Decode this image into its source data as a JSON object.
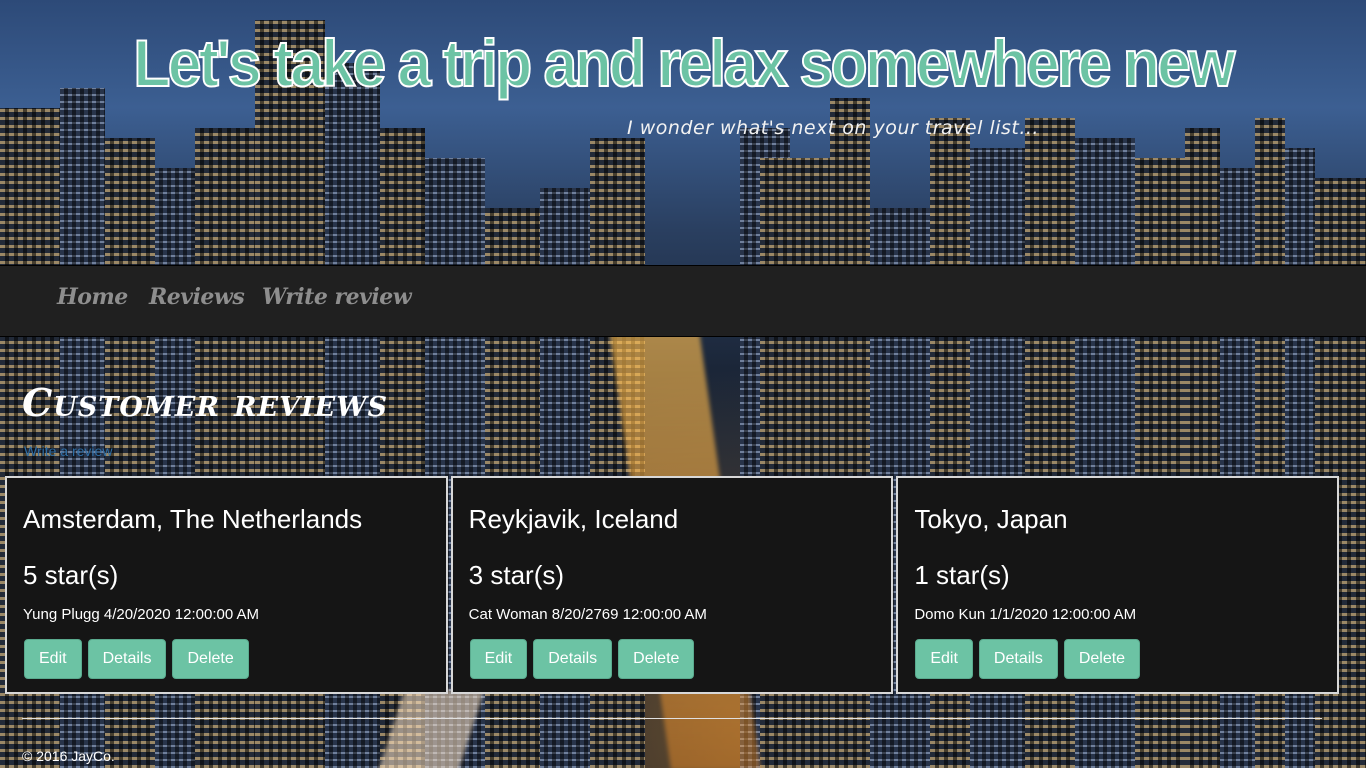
{
  "header": {
    "title": "Let's take a trip and relax somewhere new",
    "tagline": "I wonder what's next on your travel list..."
  },
  "nav": {
    "items": [
      {
        "label": "Home"
      },
      {
        "label": "Reviews"
      },
      {
        "label": "Write review"
      }
    ]
  },
  "main": {
    "heading": "Customer reviews",
    "write_link": "Write a review",
    "reviews": [
      {
        "title": "Amsterdam, The Netherlands",
        "rating": "5 star(s)",
        "meta": "Yung Plugg 4/20/2020 12:00:00 AM",
        "actions": {
          "edit": "Edit",
          "details": "Details",
          "delete": "Delete"
        }
      },
      {
        "title": "Reykjavik, Iceland",
        "rating": "3 star(s)",
        "meta": "Cat Woman 8/20/2769 12:00:00 AM",
        "actions": {
          "edit": "Edit",
          "details": "Details",
          "delete": "Delete"
        }
      },
      {
        "title": "Tokyo, Japan",
        "rating": "1 star(s)",
        "meta": "Domo Kun 1/1/2020 12:00:00 AM",
        "actions": {
          "edit": "Edit",
          "details": "Details",
          "delete": "Delete"
        }
      }
    ]
  },
  "footer": {
    "text": "© 2016 JayCo."
  },
  "colors": {
    "accent": "#6cc3a4",
    "navbar": "#202020",
    "card_bg": "#151515",
    "link": "#2e6da4"
  }
}
